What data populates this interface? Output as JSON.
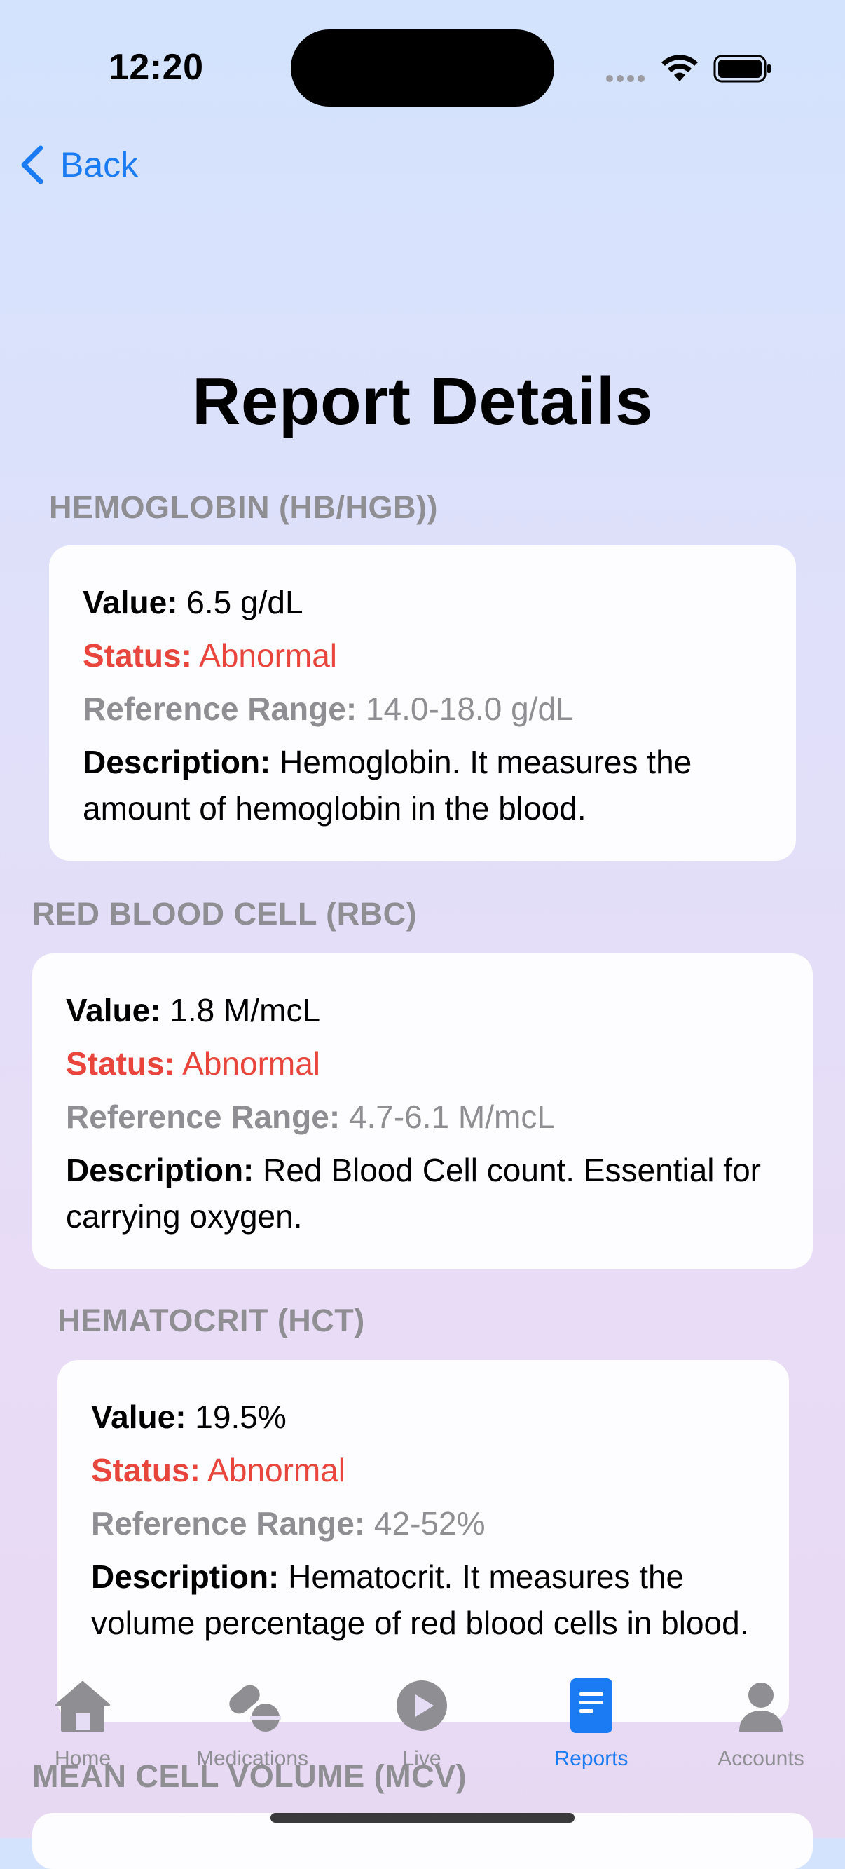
{
  "status_bar": {
    "time": "12:20"
  },
  "nav": {
    "back_label": "Back"
  },
  "page": {
    "title": "Report Details"
  },
  "labels": {
    "value": "Value:",
    "status": "Status:",
    "reference_range": "Reference Range:",
    "description": "Description:"
  },
  "reports": [
    {
      "title": "HEMOGLOBIN (HB/HGB))",
      "value": "6.5 g/dL",
      "status": "Abnormal",
      "reference_range": "14.0-18.0 g/dL",
      "description": "Hemoglobin. It measures the amount of hemoglobin in the blood."
    },
    {
      "title": "RED BLOOD CELL (RBC)",
      "value": "1.8 M/mcL",
      "status": "Abnormal",
      "reference_range": "4.7-6.1 M/mcL",
      "description": "Red Blood Cell count. Essential for carrying oxygen."
    },
    {
      "title": "HEMATOCRIT (HCT)",
      "value": "19.5%",
      "status": "Abnormal",
      "reference_range": "42-52%",
      "description": "Hematocrit. It measures the volume percentage of red blood cells in blood."
    },
    {
      "title": "MEAN CELL VOLUME (MCV)"
    }
  ],
  "tabs": [
    {
      "label": "Home",
      "icon": "house-icon",
      "active": false
    },
    {
      "label": "Medications",
      "icon": "pills-icon",
      "active": false
    },
    {
      "label": "Live",
      "icon": "play-circle-icon",
      "active": false
    },
    {
      "label": "Reports",
      "icon": "document-icon",
      "active": true
    },
    {
      "label": "Accounts",
      "icon": "person-icon",
      "active": false
    }
  ],
  "colors": {
    "accent": "#1a7bf2",
    "abnormal": "#e8453c",
    "secondary_text": "#8e8e93",
    "inactive_icon": "#8e8e93"
  }
}
